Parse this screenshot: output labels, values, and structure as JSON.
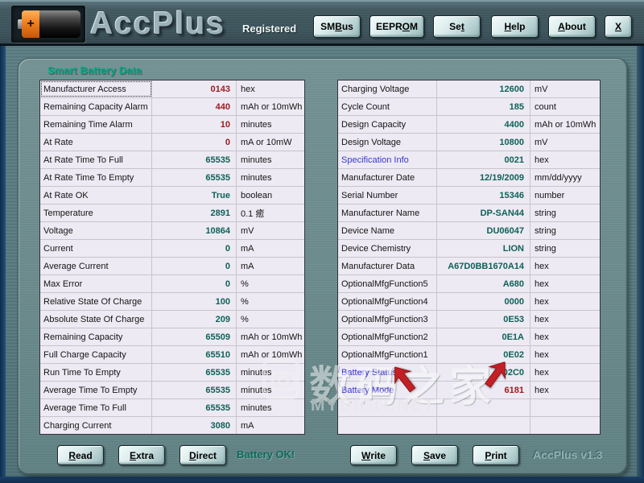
{
  "header": {
    "title": "AccPlus",
    "registered": "Registered",
    "buttons": [
      {
        "label": "SMBus",
        "hot": 2
      },
      {
        "label": "EEPROM",
        "hot": 4
      },
      {
        "label": "Set",
        "hot": 2
      },
      {
        "label": "Help",
        "hot": 0
      },
      {
        "label": "About",
        "hot": 0
      },
      {
        "label": "X",
        "hot": 0
      }
    ]
  },
  "section_title": "Smart Battery Data",
  "left_table": {
    "rows": [
      {
        "l": "Manufacturer Access",
        "v": "0143",
        "u": "hex",
        "vc": "red",
        "focus": true
      },
      {
        "l": "Remaining Capacity Alarm",
        "v": "440",
        "u": "mAh or 10mWh",
        "vc": "red"
      },
      {
        "l": "Remaining Time Alarm",
        "v": "10",
        "u": "minutes",
        "vc": "red"
      },
      {
        "l": "At Rate",
        "v": "0",
        "u": "mA or 10mW",
        "vc": "red"
      },
      {
        "l": "At Rate Time To Full",
        "v": "65535",
        "u": "minutes"
      },
      {
        "l": "At Rate Time To Empty",
        "v": "65535",
        "u": "minutes"
      },
      {
        "l": "At Rate OK",
        "v": "True",
        "u": "boolean"
      },
      {
        "l": "Temperature",
        "v": "2891",
        "u": "0.1 癒"
      },
      {
        "l": "Voltage",
        "v": "10864",
        "u": "mV"
      },
      {
        "l": "Current",
        "v": "0",
        "u": "mA"
      },
      {
        "l": "Average Current",
        "v": "0",
        "u": "mA"
      },
      {
        "l": "Max Error",
        "v": "0",
        "u": "%"
      },
      {
        "l": "Relative State Of Charge",
        "v": "100",
        "u": "%"
      },
      {
        "l": "Absolute State Of Charge",
        "v": "209",
        "u": "%"
      },
      {
        "l": "Remaining Capacity",
        "v": "65509",
        "u": "mAh or 10mWh"
      },
      {
        "l": "Full Charge Capacity",
        "v": "65510",
        "u": "mAh or 10mWh"
      },
      {
        "l": "Run Time To Empty",
        "v": "65535",
        "u": "minutes"
      },
      {
        "l": "Average Time To Empty",
        "v": "65535",
        "u": "minutes"
      },
      {
        "l": "Average Time To Full",
        "v": "65535",
        "u": "minutes"
      },
      {
        "l": "Charging Current",
        "v": "3080",
        "u": "mA"
      }
    ]
  },
  "right_table": {
    "rows": [
      {
        "l": "Charging Voltage",
        "v": "12600",
        "u": "mV"
      },
      {
        "l": "Cycle Count",
        "v": "185",
        "u": "count"
      },
      {
        "l": "Design Capacity",
        "v": "4400",
        "u": "mAh or 10mWh"
      },
      {
        "l": "Design Voltage",
        "v": "10800",
        "u": "mV"
      },
      {
        "l": "Specification Info",
        "v": "0021",
        "u": "hex",
        "lc": "blue"
      },
      {
        "l": "Manufacturer Date",
        "v": "12/19/2009",
        "u": "mm/dd/yyyy"
      },
      {
        "l": "Serial Number",
        "v": "15346",
        "u": "number"
      },
      {
        "l": "Manufacturer Name",
        "v": "DP-SAN44",
        "u": "string"
      },
      {
        "l": "Device Name",
        "v": "DU06047",
        "u": "string"
      },
      {
        "l": "Device Chemistry",
        "v": "LION",
        "u": "string"
      },
      {
        "l": "Manufacturer Data",
        "v": "A67D0BB1670A14",
        "u": "hex"
      },
      {
        "l": "OptionalMfgFunction5",
        "v": "A680",
        "u": "hex"
      },
      {
        "l": "OptionalMfgFunction4",
        "v": "0000",
        "u": "hex"
      },
      {
        "l": "OptionalMfgFunction3",
        "v": "0E53",
        "u": "hex"
      },
      {
        "l": "OptionalMfgFunction2",
        "v": "0E1A",
        "u": "hex"
      },
      {
        "l": "OptionalMfgFunction1",
        "v": "0E02",
        "u": "hex"
      },
      {
        "l": "Battery Status",
        "v": "02C0",
        "u": "hex",
        "lc": "blue"
      },
      {
        "l": "Battery Mode",
        "v": "6181",
        "u": "hex",
        "lc": "blue",
        "vc": "red"
      },
      {
        "l": "",
        "v": "",
        "u": ""
      },
      {
        "l": "",
        "v": "",
        "u": ""
      }
    ]
  },
  "footer": {
    "left_buttons": [
      {
        "label": "Read",
        "hot": 0
      },
      {
        "label": "Extra",
        "hot": 0
      },
      {
        "label": "Direct",
        "hot": 0
      }
    ],
    "status": "Battery OK!",
    "right_buttons": [
      {
        "label": "Write",
        "hot": 0
      },
      {
        "label": "Save",
        "hot": 0
      },
      {
        "label": "Print",
        "hot": 0
      }
    ],
    "version": "AccPlus v1.3"
  },
  "watermark": {
    "cjk": "数码之家",
    "site": "MYDIGIT.NET",
    "icon": "camera-icon"
  },
  "battery_icon": {
    "plus": "+"
  },
  "colors": {
    "accent_green": "#00a884",
    "value_teal": "#0e6158",
    "value_red": "#9c1a1e",
    "label_blue": "#3b35d6",
    "status_teal": "#0d6b5e",
    "arrow_red": "#c32026"
  }
}
